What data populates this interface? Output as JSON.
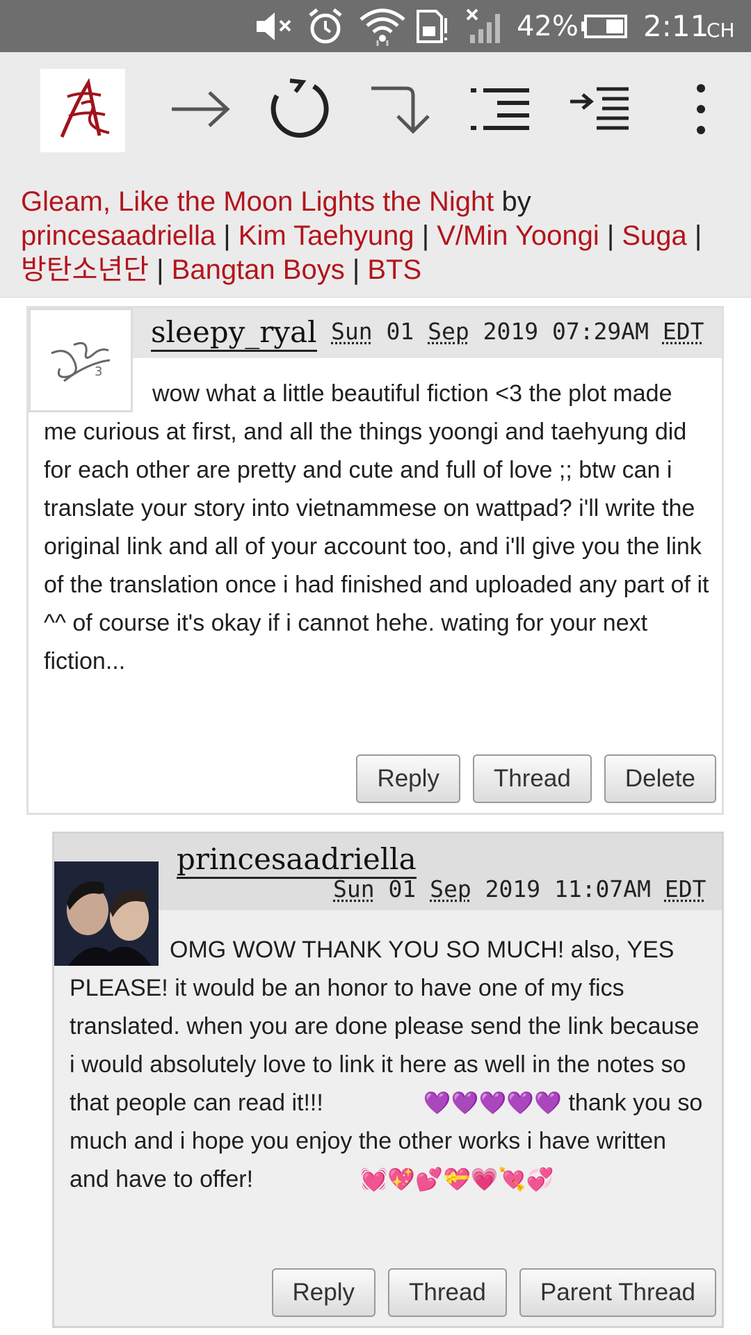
{
  "status_bar": {
    "battery_pct": "42%",
    "time": "2:11",
    "time_suffix": "CH",
    "icons": [
      "mute-icon",
      "alarm-icon",
      "wifi-icon",
      "sd-card-icon",
      "no-signal-icon",
      "battery-icon"
    ]
  },
  "toolbar": {
    "icons": [
      "ao3-logo",
      "forward-arrow-icon",
      "refresh-icon",
      "down-right-arrow-icon",
      "list-icon",
      "indent-icon",
      "more-vertical-icon"
    ]
  },
  "header": {
    "title": "Gleam, Like the Moon Lights the Night",
    "by": "by",
    "author": "princesaadriella",
    "fandoms": [
      "Kim Taehyung",
      "V/Min Yoongi",
      "Suga",
      "방탄소년단",
      "Bangtan Boys",
      "BTS"
    ],
    "separator": "|"
  },
  "comments": [
    {
      "username": "sleepy_ryal",
      "date": {
        "day": "Sun",
        "num": "01",
        "month": "Sep",
        "year": "2019",
        "time": "07:29AM",
        "tz": "EDT"
      },
      "body": "wow what a little beautiful fiction <3 the plot made me curious at first, and all the things yoongi and taehyung did for each other are pretty and cute and full of love ;; btw can i translate your story into vietnammese on wattpad? i'll write the original link and all of your account too, and i'll give you the link of the translation once i had finished and uploaded any part of it ^^ of course it's okay if i cannot hehe. wating for your next fiction...",
      "buttons": [
        "Reply",
        "Thread",
        "Delete"
      ]
    },
    {
      "username": "princesaadriella",
      "date": {
        "day": "Sun",
        "num": "01",
        "month": "Sep",
        "year": "2019",
        "time": "11:07AM",
        "tz": "EDT"
      },
      "body_text": "OMG WOW THANK YOU SO MUCH! also, YES PLEASE! it would be an honor to have one of my fics translated. when you are done please send the link because i would absolutely love to link it here as well in the notes so that people can read it!!!",
      "purple_hearts": "💜💜💜💜💜",
      "body_text2": " thank you so much and i hope you enjoy the other works i have written and have to offer! ",
      "red_hearts": "💓💖💕💝💗💘💞",
      "buttons": [
        "Reply",
        "Thread",
        "Parent Thread"
      ]
    }
  ],
  "colors": {
    "link": "#b3141b",
    "statusbar": "#6e6e6e",
    "toolbar": "#ebebeb"
  }
}
